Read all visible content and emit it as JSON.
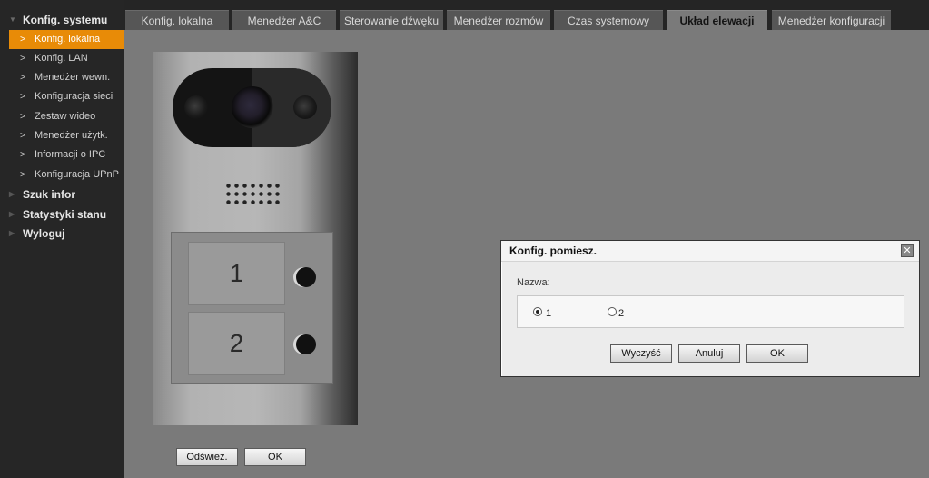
{
  "sidebar": {
    "sections": [
      {
        "label": "Konfig. systemu"
      },
      {
        "label": "Szuk infor"
      },
      {
        "label": "Statystyki stanu"
      },
      {
        "label": "Wyloguj"
      }
    ],
    "items": [
      {
        "label": "Konfig. lokalna"
      },
      {
        "label": "Konfig. LAN"
      },
      {
        "label": "Menedżer wewn."
      },
      {
        "label": "Konfiguracja sieci"
      },
      {
        "label": "Zestaw wideo"
      },
      {
        "label": "Menedżer użytk."
      },
      {
        "label": "Informacji o IPC"
      },
      {
        "label": "Konfiguracja UPnP"
      }
    ],
    "chevron": ">",
    "expanded_icon": "▼",
    "collapsed_icon": "▶"
  },
  "tabs": [
    {
      "label": "Konfig. lokalna"
    },
    {
      "label": "Menedżer A&C"
    },
    {
      "label": "Sterowanie dźwęku"
    },
    {
      "label": "Menedżer rozmów"
    },
    {
      "label": "Czas systemowy"
    },
    {
      "label": "Układ elewacji"
    },
    {
      "label": "Menedżer konfiguracji"
    }
  ],
  "panel": {
    "buttons": [
      "1",
      "2"
    ]
  },
  "actions": {
    "refresh_label": "Odśwież.",
    "ok_label": "OK"
  },
  "dialog": {
    "title": "Konfig. pomiesz.",
    "close_glyph": "✕",
    "name_label": "Nazwa:",
    "options": [
      {
        "label": "1",
        "selected": true
      },
      {
        "label": "2",
        "selected": false
      }
    ],
    "clear_label": "Wyczyść",
    "cancel_label": "Anuluj",
    "ok_label": "OK"
  },
  "colors": {
    "accent": "#e88b07",
    "sidebar_bg": "#262626",
    "content_bg": "#7a7a7a"
  }
}
